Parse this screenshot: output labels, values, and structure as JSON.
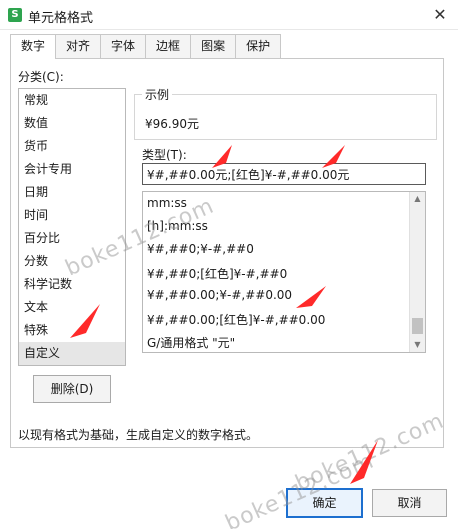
{
  "window": {
    "title": "单元格格式",
    "app_icon_letter": "S"
  },
  "tabs": [
    {
      "label": "数字",
      "active": true
    },
    {
      "label": "对齐"
    },
    {
      "label": "字体"
    },
    {
      "label": "边框"
    },
    {
      "label": "图案"
    },
    {
      "label": "保护"
    }
  ],
  "category": {
    "label": "分类(C):",
    "items": [
      "常规",
      "数值",
      "货币",
      "会计专用",
      "日期",
      "时间",
      "百分比",
      "分数",
      "科学记数",
      "文本",
      "特殊",
      "自定义"
    ],
    "selected": "自定义"
  },
  "sample": {
    "label": "示例",
    "value": "¥96.90元"
  },
  "type": {
    "label": "类型(T):",
    "value": "¥#,##0.00元;[红色]¥-#,##0.00元"
  },
  "format_list": [
    "mm:ss",
    "[h]:mm:ss",
    "¥#,##0;¥-#,##0",
    "¥#,##0;[红色]¥-#,##0",
    "¥#,##0.00;¥-#,##0.00",
    "¥#,##0.00;[红色]¥-#,##0.00",
    "G/通用格式 \"元\""
  ],
  "buttons": {
    "delete": "删除(D)",
    "ok": "确定",
    "cancel": "取消"
  },
  "description": "以现有格式为基础，生成自定义的数字格式。",
  "icons": {
    "close": "close-icon",
    "scroll_up": "triangle-up-icon",
    "scroll_down": "triangle-down-icon"
  },
  "watermark": "boke112.com",
  "colors": {
    "arrow": "#ff2a2a",
    "ok_border": "#1d6fcf",
    "app_icon": "#2ea44f"
  }
}
